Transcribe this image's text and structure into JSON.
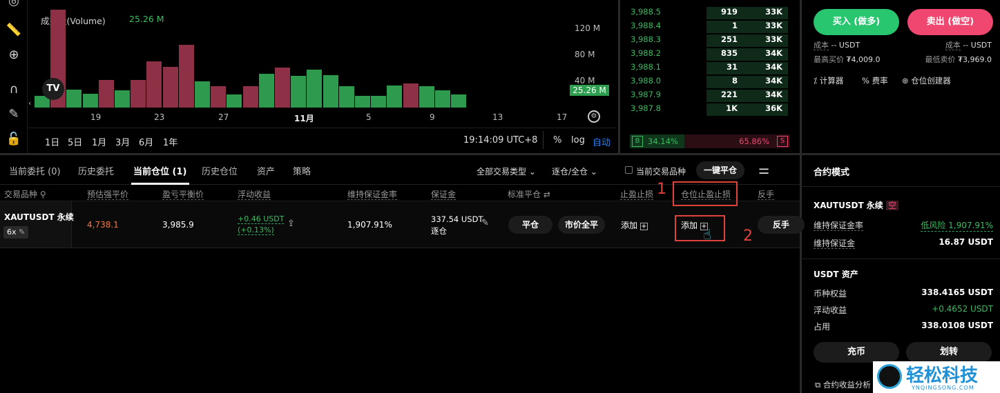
{
  "chart": {
    "volume_label": "成交量(Volume)",
    "volume_value": "25.26 M",
    "y_ticks": [
      "120 M",
      "80 M",
      "40 M"
    ],
    "last_tag": "25.26 M",
    "x_ticks": [
      "19",
      "23",
      "27",
      "11月",
      "5",
      "9",
      "13",
      "17"
    ],
    "ranges": [
      "1日",
      "5日",
      "1月",
      "3月",
      "6月",
      "1年"
    ],
    "time": "19:14:09 UTC+8",
    "percent": "%",
    "log": "log",
    "auto": "自动",
    "volume_bars": [
      {
        "v": 14,
        "c": "green"
      },
      {
        "v": 118,
        "c": "red"
      },
      {
        "v": 22,
        "c": "green"
      },
      {
        "v": 17,
        "c": "green"
      },
      {
        "v": 33,
        "c": "red"
      },
      {
        "v": 21,
        "c": "green"
      },
      {
        "v": 33,
        "c": "red"
      },
      {
        "v": 56,
        "c": "red"
      },
      {
        "v": 49,
        "c": "red"
      },
      {
        "v": 76,
        "c": "red"
      },
      {
        "v": 32,
        "c": "green"
      },
      {
        "v": 26,
        "c": "red"
      },
      {
        "v": 16,
        "c": "green"
      },
      {
        "v": 26,
        "c": "red"
      },
      {
        "v": 41,
        "c": "green"
      },
      {
        "v": 48,
        "c": "red"
      },
      {
        "v": 38,
        "c": "green"
      },
      {
        "v": 46,
        "c": "green"
      },
      {
        "v": 39,
        "c": "green"
      },
      {
        "v": 26,
        "c": "green"
      },
      {
        "v": 14,
        "c": "green"
      },
      {
        "v": 14,
        "c": "green"
      },
      {
        "v": 27,
        "c": "green"
      },
      {
        "v": 29,
        "c": "red"
      },
      {
        "v": 26,
        "c": "green"
      },
      {
        "v": 21,
        "c": "green"
      },
      {
        "v": 16,
        "c": "green"
      }
    ]
  },
  "orderbook": {
    "rows": [
      {
        "price": "3,988.5",
        "amount": "919",
        "total": "33K"
      },
      {
        "price": "3,988.4",
        "amount": "1",
        "total": "33K"
      },
      {
        "price": "3,988.3",
        "amount": "251",
        "total": "33K"
      },
      {
        "price": "3,988.2",
        "amount": "835",
        "total": "34K"
      },
      {
        "price": "3,988.1",
        "amount": "31",
        "total": "34K"
      },
      {
        "price": "3,988.0",
        "amount": "8",
        "total": "34K"
      },
      {
        "price": "3,987.9",
        "amount": "221",
        "total": "34K"
      },
      {
        "price": "3,987.8",
        "amount": "1K",
        "total": "36K"
      }
    ],
    "buy_label": "B",
    "buy_pct": "34.14%",
    "sell_pct": "65.86%",
    "sell_label": "S",
    "buy_ratio": 0.3414
  },
  "trade": {
    "buy": "买入 (做多)",
    "sell": "卖出 (做空)",
    "cost_label": "成本",
    "cost_left": "-- USDT",
    "cost_right": "-- USDT",
    "max_buy_label": "最高买价",
    "max_buy": "₮4,009.0",
    "min_sell_label": "最低卖价",
    "min_sell": "₮3,969.0",
    "tools": [
      "计算器",
      "费率",
      "仓位创建器"
    ]
  },
  "tabs": {
    "items": [
      "当前委托 (0)",
      "历史委托",
      "当前仓位 (1)",
      "历史仓位",
      "资产",
      "策略"
    ],
    "filter_type": "全部交易类型",
    "filter_margin": "逐仓/全仓",
    "only_current": "当前交易品种",
    "close_all": "一键平仓"
  },
  "table": {
    "headers": [
      "交易品种",
      "预估强平价",
      "盈亏平衡价",
      "浮动收益",
      "维持保证金率",
      "保证金",
      "标准平仓",
      "止盈止损",
      "仓位止盈止损",
      "反手"
    ],
    "row": {
      "symbol": "XAUTUSDT 永续",
      "leverage": "6x",
      "liq_price": "4,738.1",
      "breakeven": "3,985.9",
      "pnl": "+0.46 USDT",
      "pnl_pct": "(+0.13%)",
      "mmr": "1,907.91%",
      "margin": "337.54 USDT",
      "margin_mode": "逐仓",
      "close": "平仓",
      "market_close": "市价全平",
      "tpsl_add": "添加",
      "pos_tpsl_add": "添加",
      "reverse": "反手"
    }
  },
  "annotations": [
    "1",
    "2"
  ],
  "right_panel": {
    "title": "合约模式",
    "symbol": "XAUTUSDT 永续",
    "side": "空",
    "mmr_label": "维持保证金率",
    "mmr_value": "低风险 1,907.91%",
    "mm_label": "维持保证金",
    "mm_value": "16.87 USDT",
    "asset_title": "USDT 资产",
    "equity_label": "币种权益",
    "equity": "338.4165 USDT",
    "pnl_label": "浮动收益",
    "pnl": "+0.4652 USDT",
    "used_label": "占用",
    "used": "338.0108 USDT",
    "deposit": "充币",
    "transfer": "划转",
    "analysis": "合约收益分析"
  },
  "watermark": {
    "text": "轻松科技",
    "sub": "YNQINGSONG.COM"
  },
  "colors": {
    "green": "#2e9a4e",
    "red": "#8e3147",
    "accent": "#28c76f",
    "sell": "#ef476f"
  }
}
